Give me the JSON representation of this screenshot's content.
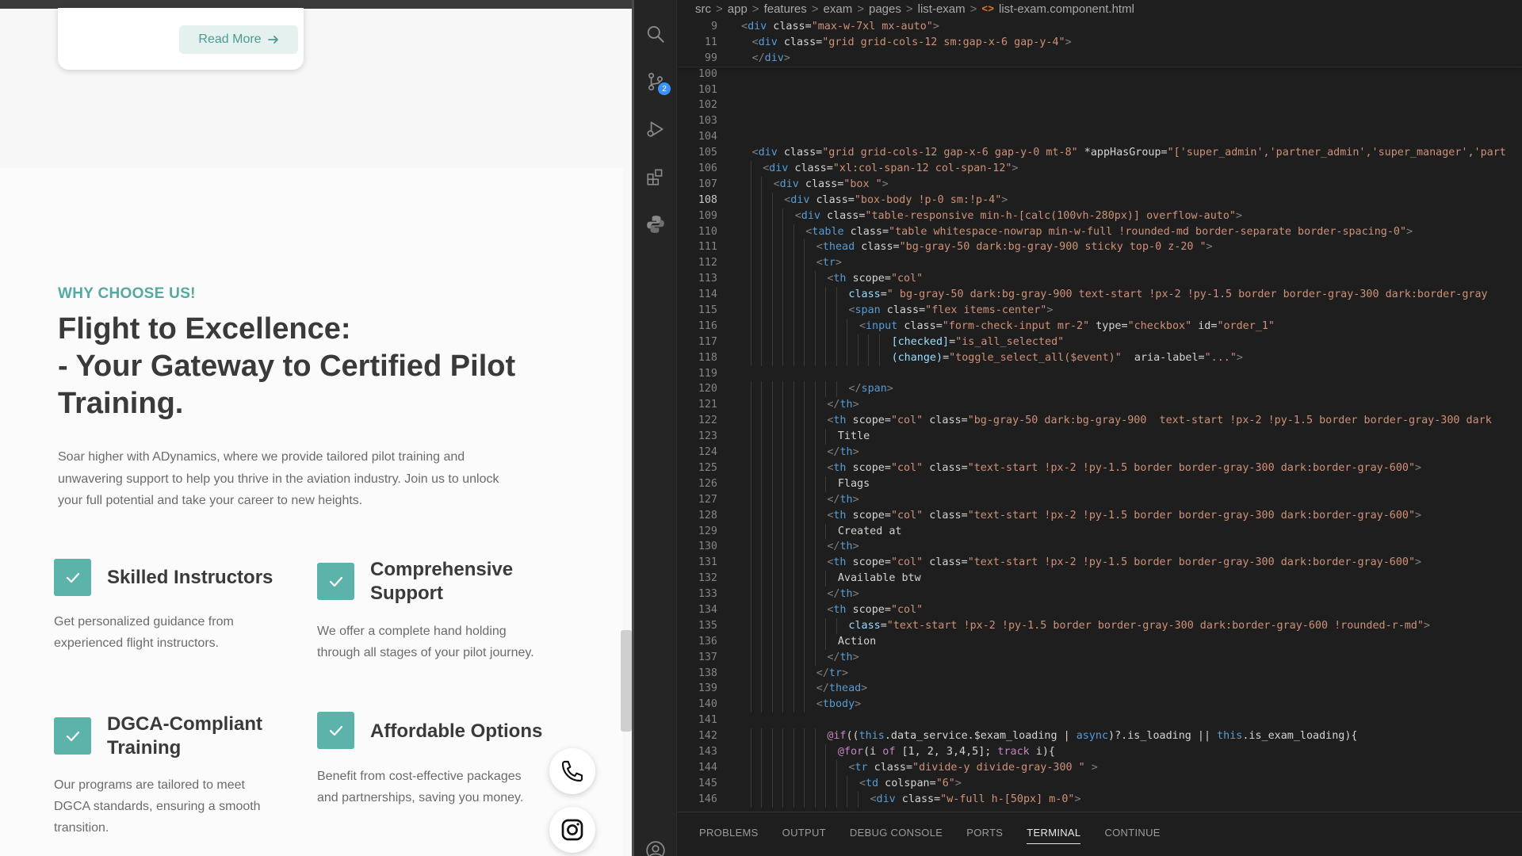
{
  "website": {
    "read_more": "Read More",
    "eyebrow": "WHY CHOOSE US!",
    "headline": [
      "Flight to Excellence:",
      "- Your Gateway to Certified Pilot",
      "Training."
    ],
    "intro": [
      "Soar higher with ADynamics, where we provide tailored pilot training and",
      "unwavering support to help you thrive in the aviation industry. Join us to unlock",
      "your full potential and take your career to new heights."
    ],
    "features": [
      {
        "title": [
          "Skilled Instructors"
        ],
        "description": [
          "Get personalized guidance from",
          "experienced flight instructors."
        ]
      },
      {
        "title": [
          "Comprehensive",
          "Support"
        ],
        "description": [
          "We offer a complete hand holding",
          "through all stages of your pilot journey."
        ]
      },
      {
        "title": [
          "DGCA-Compliant",
          "Training"
        ],
        "description": [
          "Our programs are tailored to meet",
          "DGCA standards, ensuring a smooth",
          "transition."
        ]
      },
      {
        "title": [
          "Affordable Options"
        ],
        "description": [
          "Benefit from cost-effective packages",
          "and partnerships, saving you money."
        ]
      }
    ],
    "colors": {
      "accent": "#5cb3a9",
      "heading": "#3a3a3a"
    }
  },
  "editor": {
    "breadcrumb": [
      "src",
      "app",
      "features",
      "exam",
      "pages",
      "list-exam"
    ],
    "file_icon": "<>",
    "file_name": "list-exam.component.html",
    "activity_icons": [
      "search-icon",
      "source-control-icon",
      "run-debug-icon",
      "extensions-icon",
      "python-icon",
      "account-icon"
    ],
    "source_control_badge": "2",
    "active_line": 108,
    "lines": [
      {
        "n": 9,
        "indent": 0,
        "text": "<div class=\"max-w-7xl mx-auto\">"
      },
      {
        "n": 11,
        "indent": 1,
        "text": "<div class=\"grid grid-cols-12 sm:gap-x-6 gap-y-4\">"
      },
      {
        "n": 99,
        "indent": 1,
        "text": "</div>"
      },
      {
        "n": 100,
        "indent": 0,
        "text": ""
      },
      {
        "n": 101,
        "indent": 0,
        "text": ""
      },
      {
        "n": 102,
        "indent": 0,
        "text": ""
      },
      {
        "n": 103,
        "indent": 0,
        "text": ""
      },
      {
        "n": 104,
        "indent": 0,
        "text": ""
      },
      {
        "n": 105,
        "indent": 1,
        "text": "<div class=\"grid grid-cols-12 gap-x-6 gap-y-0 mt-8\" *appHasGroup=\"['super_admin','partner_admin','super_manager','part"
      },
      {
        "n": 106,
        "indent": 2,
        "text": "<div class=\"xl:col-span-12 col-span-12\">"
      },
      {
        "n": 107,
        "indent": 3,
        "text": "<div class=\"box \">"
      },
      {
        "n": 108,
        "indent": 4,
        "text": "<div class=\"box-body !p-0 sm:!p-4\">"
      },
      {
        "n": 109,
        "indent": 5,
        "text": "<div class=\"table-responsive min-h-[calc(100vh-280px)] overflow-auto\">"
      },
      {
        "n": 110,
        "indent": 6,
        "text": "<table class=\"table whitespace-nowrap min-w-full !rounded-md border-separate border-spacing-0\">"
      },
      {
        "n": 111,
        "indent": 7,
        "text": "<thead class=\"bg-gray-50 dark:bg-gray-900 sticky top-0 z-20 \">"
      },
      {
        "n": 112,
        "indent": 7,
        "text": "<tr>"
      },
      {
        "n": 113,
        "indent": 8,
        "text": "<th scope=\"col\""
      },
      {
        "n": 114,
        "indent": 10,
        "text": "class=\" bg-gray-50 dark:bg-gray-900 text-start !px-2 !py-1.5 border border-gray-300 dark:border-gray"
      },
      {
        "n": 115,
        "indent": 10,
        "text": "<span class=\"flex items-center\">"
      },
      {
        "n": 116,
        "indent": 11,
        "text": "<input class=\"form-check-input mr-2\" type=\"checkbox\" id=\"order_1\""
      },
      {
        "n": 117,
        "indent": 14,
        "text": "[checked]=\"is_all_selected\""
      },
      {
        "n": 118,
        "indent": 14,
        "text": "(change)=\"toggle_select_all($event)\"  aria-label=\"...\">"
      },
      {
        "n": 119,
        "indent": 0,
        "text": ""
      },
      {
        "n": 120,
        "indent": 10,
        "text": "</span>"
      },
      {
        "n": 121,
        "indent": 8,
        "text": "</th>"
      },
      {
        "n": 122,
        "indent": 8,
        "text": "<th scope=\"col\" class=\"bg-gray-50 dark:bg-gray-900  text-start !px-2 !py-1.5 border border-gray-300 dark"
      },
      {
        "n": 123,
        "indent": 9,
        "text": "Title"
      },
      {
        "n": 124,
        "indent": 8,
        "text": "</th>"
      },
      {
        "n": 125,
        "indent": 8,
        "text": "<th scope=\"col\" class=\"text-start !px-2 !py-1.5 border border-gray-300 dark:border-gray-600\">"
      },
      {
        "n": 126,
        "indent": 9,
        "text": "Flags"
      },
      {
        "n": 127,
        "indent": 8,
        "text": "</th>"
      },
      {
        "n": 128,
        "indent": 8,
        "text": "<th scope=\"col\" class=\"text-start !px-2 !py-1.5 border border-gray-300 dark:border-gray-600\">"
      },
      {
        "n": 129,
        "indent": 9,
        "text": "Created at"
      },
      {
        "n": 130,
        "indent": 8,
        "text": "</th>"
      },
      {
        "n": 131,
        "indent": 8,
        "text": "<th scope=\"col\" class=\"text-start !px-2 !py-1.5 border border-gray-300 dark:border-gray-600\">"
      },
      {
        "n": 132,
        "indent": 9,
        "text": "Available btw"
      },
      {
        "n": 133,
        "indent": 8,
        "text": "</th>"
      },
      {
        "n": 134,
        "indent": 8,
        "text": "<th scope=\"col\""
      },
      {
        "n": 135,
        "indent": 10,
        "text": "class=\"text-start !px-2 !py-1.5 border border-gray-300 dark:border-gray-600 !rounded-r-md\">"
      },
      {
        "n": 136,
        "indent": 9,
        "text": "Action"
      },
      {
        "n": 137,
        "indent": 8,
        "text": "</th>"
      },
      {
        "n": 138,
        "indent": 7,
        "text": "</tr>"
      },
      {
        "n": 139,
        "indent": 7,
        "text": "</thead>"
      },
      {
        "n": 140,
        "indent": 7,
        "text": "<tbody>"
      },
      {
        "n": 141,
        "indent": 0,
        "text": ""
      },
      {
        "n": 142,
        "indent": 8,
        "text": "@if((this.data_service.$exam_loading | async)?.is_loading || this.is_exam_loading){"
      },
      {
        "n": 143,
        "indent": 9,
        "text": "@for(i of [1, 2, 3,4,5]; track i){"
      },
      {
        "n": 144,
        "indent": 10,
        "text": "<tr class=\"divide-y divide-gray-300 \" >"
      },
      {
        "n": 145,
        "indent": 11,
        "text": "<td colspan=\"6\">"
      },
      {
        "n": 146,
        "indent": 12,
        "text": "<div class=\"w-full h-[50px] m-0\">"
      }
    ],
    "panel_tabs": [
      "PROBLEMS",
      "OUTPUT",
      "DEBUG CONSOLE",
      "PORTS",
      "TERMINAL",
      "CONTINUE"
    ],
    "active_panel_tab": "TERMINAL",
    "colors": {
      "background": "#1e1e1e",
      "tag": "#569cd6",
      "attribute": "#9cdcfe",
      "string": "#ce9178",
      "text": "#d4d4d4",
      "keyword": "#c586c0"
    }
  }
}
